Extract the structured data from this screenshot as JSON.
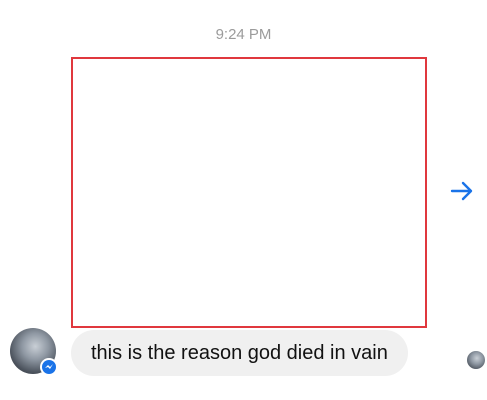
{
  "conversation": {
    "timestamp": "9:24 PM",
    "message": {
      "text": "this is the reason god died in vain"
    }
  },
  "colors": {
    "timestamp_text": "#9b9b9b",
    "image_border": "#e0383e",
    "bubble_background": "#f0f0f0",
    "accent": "#1a73e8"
  },
  "icons": {
    "forward": "forward-arrow-icon",
    "messenger_badge": "messenger-badge-icon"
  }
}
